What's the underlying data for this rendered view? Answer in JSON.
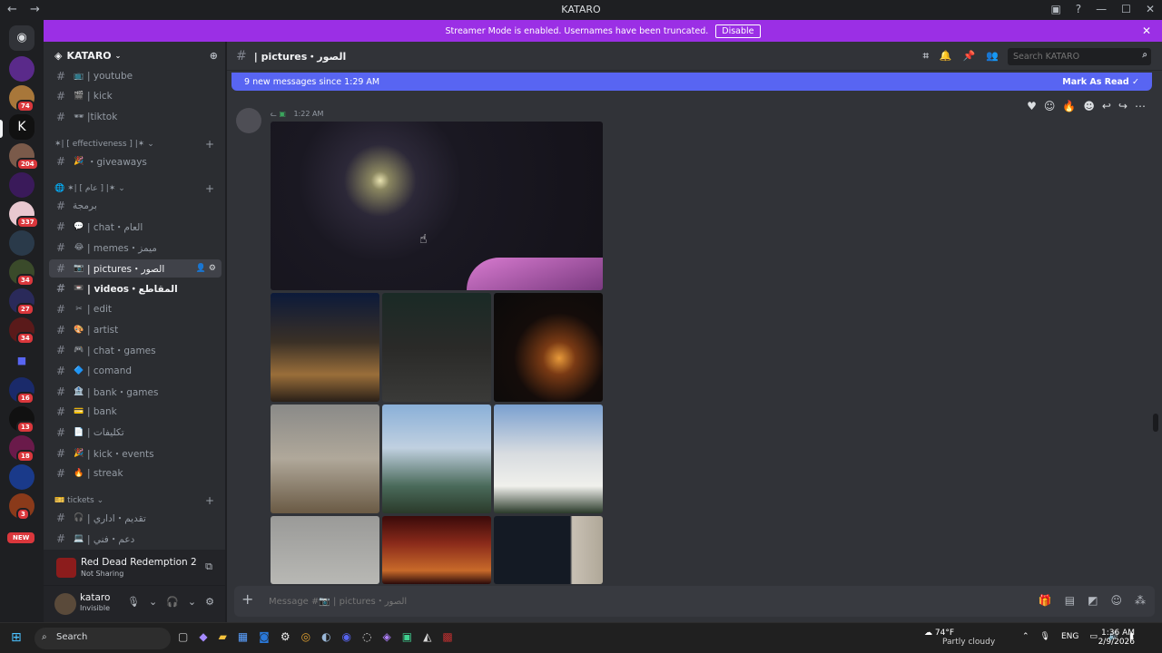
{
  "window": {
    "title": "KATARO",
    "back": "←",
    "forward": "→"
  },
  "banner": {
    "text": "Streamer Mode is enabled. Usernames have been truncated.",
    "disable_label": "Disable"
  },
  "guild_badges": [
    "74",
    "204",
    "337",
    "34",
    "27",
    "34",
    "16",
    "13",
    "18",
    "3",
    "NEW"
  ],
  "server": {
    "name": "KATARO"
  },
  "channels": [
    {
      "emoji": "📺",
      "name": "| youtube"
    },
    {
      "emoji": "🎬",
      "name": "| kick"
    },
    {
      "emoji": "🕶",
      "name": "|tiktok"
    }
  ],
  "categories": {
    "effectiveness": "✶| [ effectiveness ] |✶",
    "general": "✶| [ عام ] |✶",
    "tickets": "tickets"
  },
  "channels_eff": [
    {
      "emoji": "🎉",
      "name": "・giveaways"
    }
  ],
  "channels_general": [
    {
      "emoji": "",
      "name": "برمجة"
    },
    {
      "emoji": "💬",
      "name": "| chat・العام"
    },
    {
      "emoji": "😂",
      "name": "| memes・ميمز"
    },
    {
      "emoji": "📷",
      "name": "| pictures・الصور"
    },
    {
      "emoji": "📼",
      "name": "| videos・المقاطع"
    },
    {
      "emoji": "✂",
      "name": "| edit"
    },
    {
      "emoji": "🎨",
      "name": "| artist"
    },
    {
      "emoji": "🎮",
      "name": "| chat・games"
    },
    {
      "emoji": "🔷",
      "name": "| comand"
    },
    {
      "emoji": "🏦",
      "name": "| bank・games"
    },
    {
      "emoji": "💳",
      "name": "| bank"
    },
    {
      "emoji": "📄",
      "name": "| تكليفات"
    },
    {
      "emoji": "🎉",
      "name": "| kick・events"
    },
    {
      "emoji": "🔥",
      "name": "| streak"
    }
  ],
  "channels_tickets": [
    {
      "emoji": "🎧",
      "name": "| تقديم・اداري"
    },
    {
      "emoji": "💻",
      "name": "| دعم・فني"
    }
  ],
  "activity": {
    "game": "Red Dead Redemption 2",
    "status": "Not Sharing"
  },
  "user": {
    "name": "kataro",
    "status": "Invisible"
  },
  "header": {
    "channel": "| pictures・الصور",
    "search_placeholder": "Search KATARO"
  },
  "new_messages": {
    "text": "9 new messages since 1:29 AM",
    "mark_read": "Mark As Read"
  },
  "message": {
    "prefix": "ᓚ",
    "time": "1:22 AM"
  },
  "composer": {
    "placeholder": "Message #📷 | pictures・الصور"
  },
  "taskbar": {
    "search": "Search",
    "temp": "74°F",
    "weather": "Partly cloudy",
    "lang": "ENG",
    "time": "1:36 AM",
    "date": "2/9/2026"
  }
}
